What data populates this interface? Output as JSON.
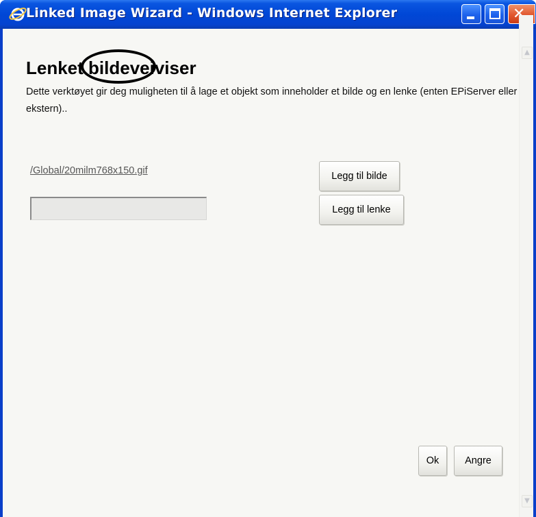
{
  "window": {
    "title": "Linked Image Wizard - Windows Internet Explorer",
    "close_glyph": "✕",
    "icons": [
      "internet-explorer-icon",
      "minimize-icon",
      "maximize-icon",
      "close-icon"
    ]
  },
  "page": {
    "heading": "Lenket bildeveiviser",
    "description": "Dette verktøyet gir deg muligheten til å lage et objekt som inneholder et bilde og en lenke (enten EPiServer eller ekstern)..",
    "image_path": "/Global/20milm768x150.gif",
    "link_value": "",
    "buttons": {
      "add_image": "Legg til bilde",
      "add_link": "Legg til lenke",
      "ok": "Ok",
      "cancel": "Angre"
    }
  },
  "scrollbar": {
    "up_arrow": "▲",
    "down_arrow": "▼"
  },
  "colors": {
    "titlebar": "#0047d6",
    "client_background": "#f7f7f4",
    "annotation_circle": "#000000"
  }
}
